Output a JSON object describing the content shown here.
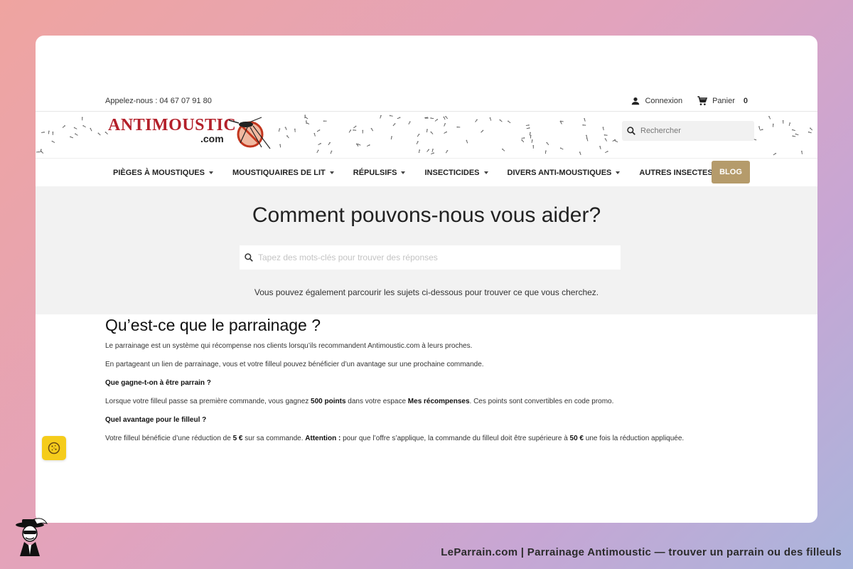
{
  "topbar": {
    "phone_text": "Appelez-nous : 04 67 07 91 80",
    "login_label": "Connexion",
    "cart_label": "Panier",
    "cart_count": "0"
  },
  "header": {
    "logo_word": "ANTIMOUSTIC",
    "logo_suffix": ".com",
    "search_placeholder": "Rechercher"
  },
  "nav": {
    "items": [
      {
        "label": "Pièges à moustiques"
      },
      {
        "label": "Moustiquaires de lit"
      },
      {
        "label": "Répulsifs"
      },
      {
        "label": "Insecticides"
      },
      {
        "label": "Divers anti-moustiques"
      },
      {
        "label": "Autres insectes"
      }
    ],
    "blog_label": "BLOG"
  },
  "hero": {
    "title": "Comment pouvons-nous vous aider?",
    "search_placeholder": "Tapez des mots-clés pour trouver des réponses",
    "subtitle": "Vous pouvez également parcourir les sujets ci-dessous pour trouver ce que vous cherchez."
  },
  "article": {
    "title": "Qu’est-ce que le parrainage ?",
    "p1": "Le parrainage est un système qui récompense nos clients lorsqu’ils recommandent Antimoustic.com à leurs proches.",
    "p2": "En partageant un lien de parrainage, vous et votre filleul pouvez bénéficier d’un avantage sur une prochaine commande.",
    "q1": "Que gagne-t-on à être parrain ?",
    "a1_part1": "Lorsque votre filleul passe sa première commande, vous gagnez ",
    "a1_bold1": "500 points",
    "a1_part2": " dans votre espace ",
    "a1_bold2": "Mes récompenses",
    "a1_part3": ". Ces points sont convertibles en code promo.",
    "q2": "Quel avantage pour le filleul ?",
    "a2_part1": "Votre filleul bénéficie d’une réduction de ",
    "a2_bold1": "5 €",
    "a2_part2": " sur sa commande. ",
    "a2_bold2": "Attention :",
    "a2_part3": " pour que l’offre s’applique, la commande du filleul doit être supérieure à ",
    "a2_bold3": "50 €",
    "a2_part4": " une fois la réduction appliquée."
  },
  "footer": {
    "caption": "LeParrain.com | Parrainage Antimoustic — trouver un parrain ou des filleuls"
  },
  "colors": {
    "brand_red": "#b3202a",
    "blog_bg": "#b59b6b",
    "hero_bg": "#f2f2f2",
    "cookie_bg": "#f5cc1b"
  },
  "icons": {
    "login": "person-icon",
    "cart": "cart-icon",
    "search": "search-icon",
    "cookie": "cookie-icon",
    "mosquito": "mosquito-icon"
  }
}
